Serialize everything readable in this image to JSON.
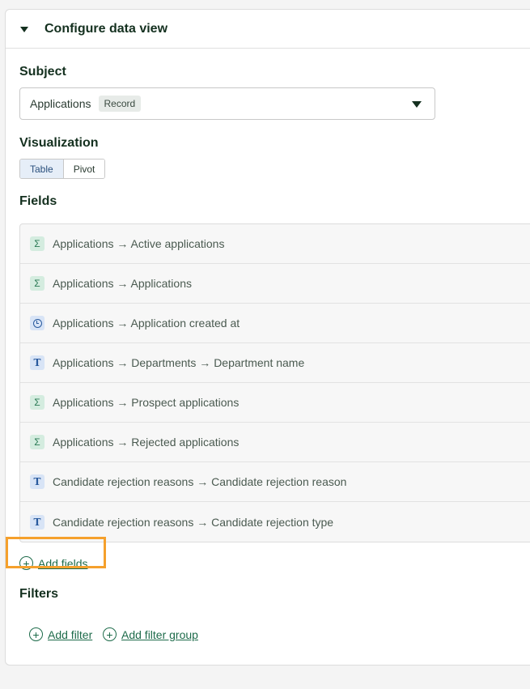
{
  "panel": {
    "title": "Configure data view"
  },
  "subject": {
    "label": "Subject",
    "value": "Applications",
    "badge": "Record"
  },
  "visualization": {
    "label": "Visualization",
    "options": [
      "Table",
      "Pivot"
    ],
    "selected": "Table"
  },
  "fields": {
    "label": "Fields",
    "items": [
      {
        "icon": "sigma-icon",
        "type": "sum",
        "glyph": "Σ",
        "label": "Applications → Active applications"
      },
      {
        "icon": "sigma-icon",
        "type": "sum",
        "glyph": "Σ",
        "label": "Applications → Applications"
      },
      {
        "icon": "clock-icon",
        "type": "time",
        "glyph": "",
        "label": "Applications → Application created at"
      },
      {
        "icon": "text-icon",
        "type": "text",
        "glyph": "T",
        "label": "Applications → Departments → Department name"
      },
      {
        "icon": "sigma-icon",
        "type": "sum",
        "glyph": "Σ",
        "label": "Applications → Prospect applications"
      },
      {
        "icon": "sigma-icon",
        "type": "sum",
        "glyph": "Σ",
        "label": "Applications → Rejected applications"
      },
      {
        "icon": "text-icon",
        "type": "text",
        "glyph": "T",
        "label": "Candidate rejection reasons → Candidate rejection reason"
      },
      {
        "icon": "text-icon",
        "type": "text",
        "glyph": "T",
        "label": "Candidate rejection reasons → Candidate rejection type"
      }
    ],
    "add_label": "Add fields"
  },
  "filters": {
    "label": "Filters",
    "add_filter_label": "Add filter",
    "add_group_label": "Add filter group"
  },
  "colors": {
    "accent": "#1d6b4a",
    "highlight": "#f5a02c"
  }
}
